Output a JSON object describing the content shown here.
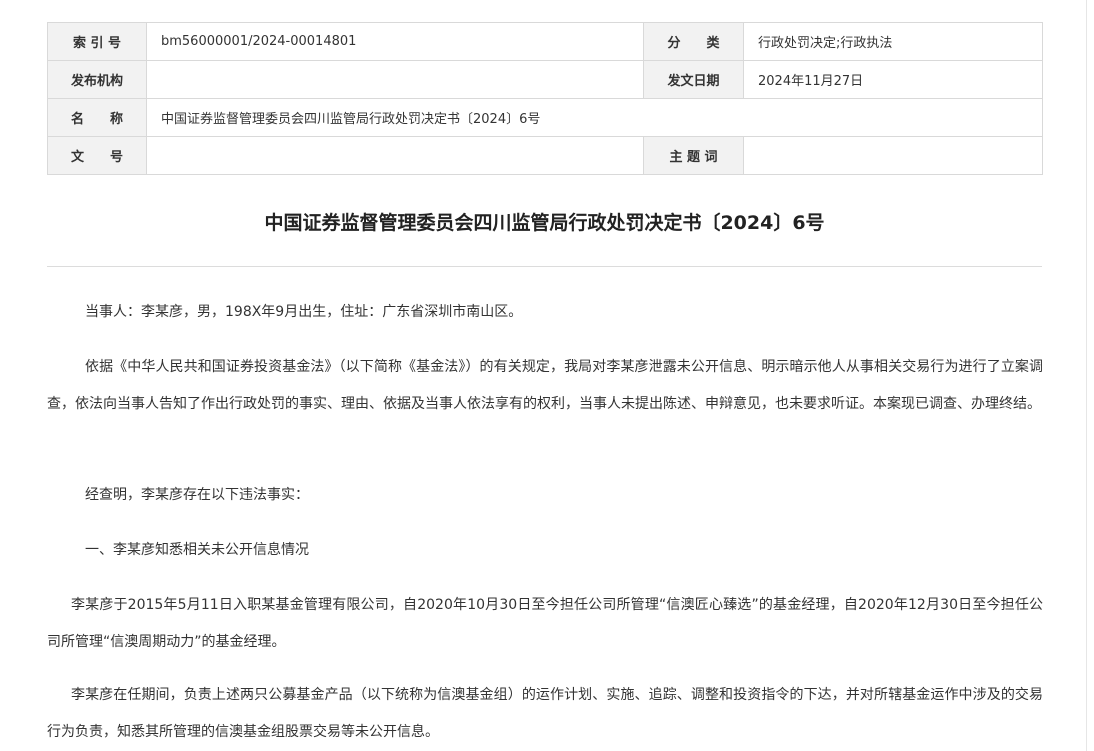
{
  "meta": {
    "index_label": "索 引 号",
    "index_value": "bm56000001/2024-00014801",
    "category_label": "分　　类",
    "category_value": "行政处罚决定;行政执法",
    "publisher_label": "发布机构",
    "publisher_value": "",
    "date_label": "发文日期",
    "date_value": "2024年11月27日",
    "name_label": "名　　称",
    "name_value": "中国证券监督管理委员会四川监管局行政处罚决定书〔2024〕6号",
    "docno_label": "文　　号",
    "docno_value": "",
    "keywords_label": "主 题 词",
    "keywords_value": ""
  },
  "document": {
    "title": "中国证券监督管理委员会四川监管局行政处罚决定书〔2024〕6号",
    "paragraphs": [
      "当事人：李某彦，男，198X年9月出生，住址：广东省深圳市南山区。",
      "依据《中华人民共和国证券投资基金法》（以下简称《基金法》）的有关规定，我局对李某彦泄露未公开信息、明示暗示他人从事相关交易行为进行了立案调查，依法向当事人告知了作出行政处罚的事实、理由、依据及当事人依法享有的权利，当事人未提出陈述、申辩意见，也未要求听证。本案现已调查、办理终结。",
      "经查明，李某彦存在以下违法事实：",
      "一、李某彦知悉相关未公开信息情况",
      "李某彦于2015年5月11日入职某基金管理有限公司，自2020年10月30日至今担任公司所管理“信澳匠心臻选”的基金经理，自2020年12月30日至今担任公司所管理“信澳周期动力”的基金经理。",
      "李某彦在任期间，负责上述两只公募基金产品（以下统称为信澳基金组）的运作计划、实施、追踪、调整和投资指令的下达，并对所辖基金运作中涉及的交易行为负责，知悉其所管理的信澳基金组股票交易等未公开信息。"
    ]
  }
}
